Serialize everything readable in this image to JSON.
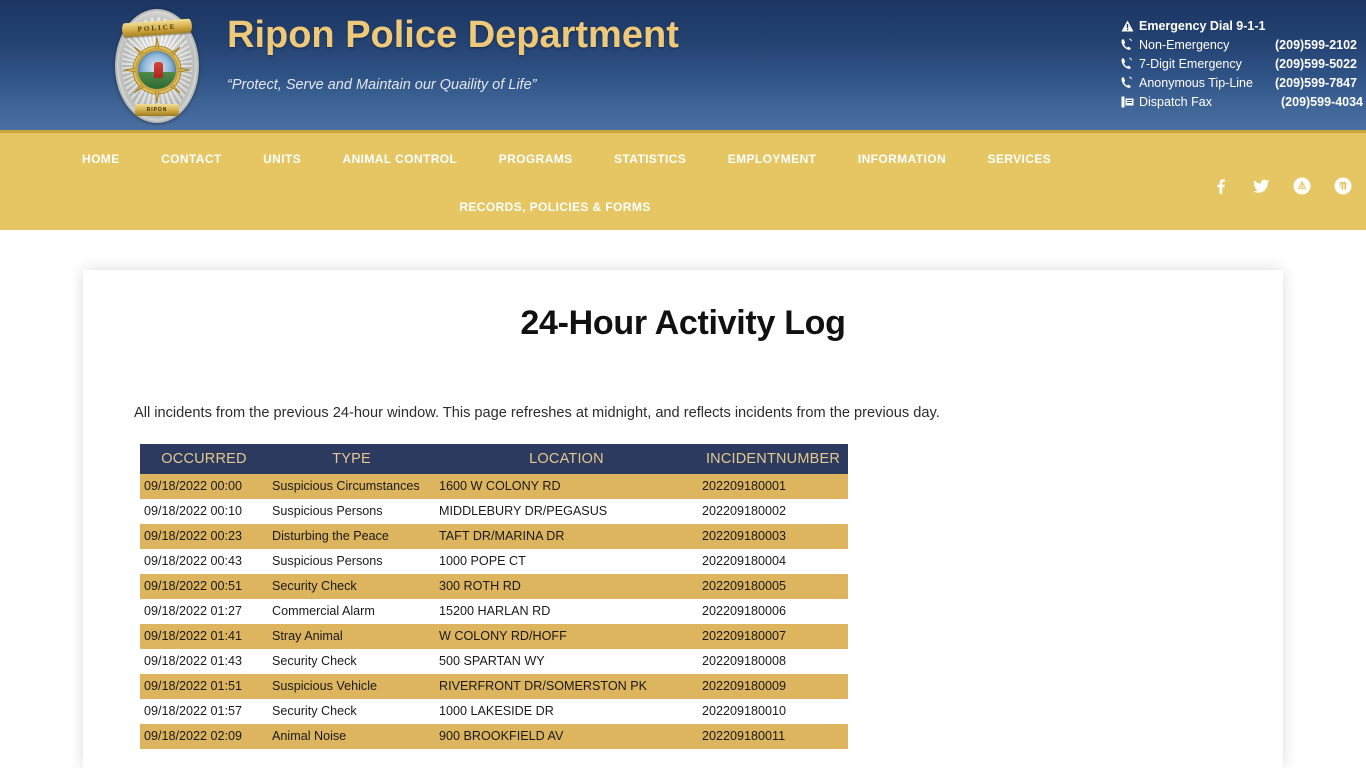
{
  "header": {
    "department_title": "Ripon Police Department",
    "tagline": "“Protect, Serve and Maintain our Quaility of Life”",
    "badge": {
      "banner_text": "POLICE",
      "bottom_text": "RIPON",
      "icon": "police-badge-icon"
    },
    "contacts": [
      {
        "icon": "warning-icon",
        "label": "Emergency Dial 9-1-1",
        "number": "",
        "emphasis": true
      },
      {
        "icon": "phone-icon",
        "label": "Non-Emergency",
        "number": "(209)599-2102",
        "emphasis": false
      },
      {
        "icon": "phone-icon",
        "label": "7-Digit Emergency",
        "number": "(209)599-5022",
        "emphasis": false
      },
      {
        "icon": "phone-icon",
        "label": "Anonymous Tip-Line",
        "number": "(209)599-7847",
        "emphasis": false
      },
      {
        "icon": "fax-icon",
        "label": "Dispatch Fax",
        "number": "(209)599-4034",
        "emphasis": false
      }
    ]
  },
  "nav": {
    "primary": [
      {
        "label": "HOME"
      },
      {
        "label": "CONTACT"
      },
      {
        "label": "UNITS"
      },
      {
        "label": "ANIMAL CONTROL"
      },
      {
        "label": "PROGRAMS"
      },
      {
        "label": "STATISTICS"
      },
      {
        "label": "EMPLOYMENT"
      },
      {
        "label": "INFORMATION"
      },
      {
        "label": "SERVICES"
      }
    ],
    "secondary": [
      {
        "label": "RECORDS, POLICIES & FORMS"
      }
    ],
    "social": [
      {
        "name": "facebook-icon"
      },
      {
        "name": "twitter-icon"
      },
      {
        "name": "city-seal-icon"
      },
      {
        "name": "nextdoor-icon"
      }
    ]
  },
  "main": {
    "title": "24-Hour Activity Log",
    "description": "All incidents from the previous 24-hour window.  This page refreshes at midnight, and reflects incidents from the previous day."
  },
  "table": {
    "columns": [
      "OCCURRED",
      "TYPE",
      "LOCATION",
      "INCIDENTNUMBER"
    ],
    "rows": [
      {
        "occurred": "09/18/2022 00:00",
        "type": "Suspicious Circumstances",
        "location": "1600 W COLONY RD",
        "incident": "202209180001"
      },
      {
        "occurred": "09/18/2022 00:10",
        "type": "Suspicious Persons",
        "location": "MIDDLEBURY DR/PEGASUS",
        "incident": "202209180002"
      },
      {
        "occurred": "09/18/2022 00:23",
        "type": "Disturbing the Peace",
        "location": "TAFT DR/MARINA DR",
        "incident": "202209180003"
      },
      {
        "occurred": "09/18/2022 00:43",
        "type": "Suspicious Persons",
        "location": "1000 POPE CT",
        "incident": "202209180004"
      },
      {
        "occurred": "09/18/2022 00:51",
        "type": "Security Check",
        "location": "300 ROTH RD",
        "incident": "202209180005"
      },
      {
        "occurred": "09/18/2022 01:27",
        "type": "Commercial Alarm",
        "location": "15200 HARLAN RD",
        "incident": "202209180006"
      },
      {
        "occurred": "09/18/2022 01:41",
        "type": "Stray Animal",
        "location": "W COLONY RD/HOFF",
        "incident": "202209180007"
      },
      {
        "occurred": "09/18/2022 01:43",
        "type": "Security Check",
        "location": "500 SPARTAN WY",
        "incident": "202209180008"
      },
      {
        "occurred": "09/18/2022 01:51",
        "type": "Suspicious Vehicle",
        "location": "RIVERFRONT DR/SOMERSTON PK",
        "incident": "202209180009"
      },
      {
        "occurred": "09/18/2022 01:57",
        "type": "Security Check",
        "location": "1000 LAKESIDE DR",
        "incident": "202209180010"
      },
      {
        "occurred": "09/18/2022 02:09",
        "type": "Animal Noise",
        "location": "900 BROOKFIELD AV",
        "incident": "202209180011"
      }
    ]
  },
  "colors": {
    "header_top": "#1b3663",
    "header_bottom": "#4a6fa0",
    "nav_gold": "#e6c662",
    "title_gold": "#eec97a",
    "table_header_navy": "#2b3a5e",
    "table_row_gold": "#ddb55f"
  }
}
